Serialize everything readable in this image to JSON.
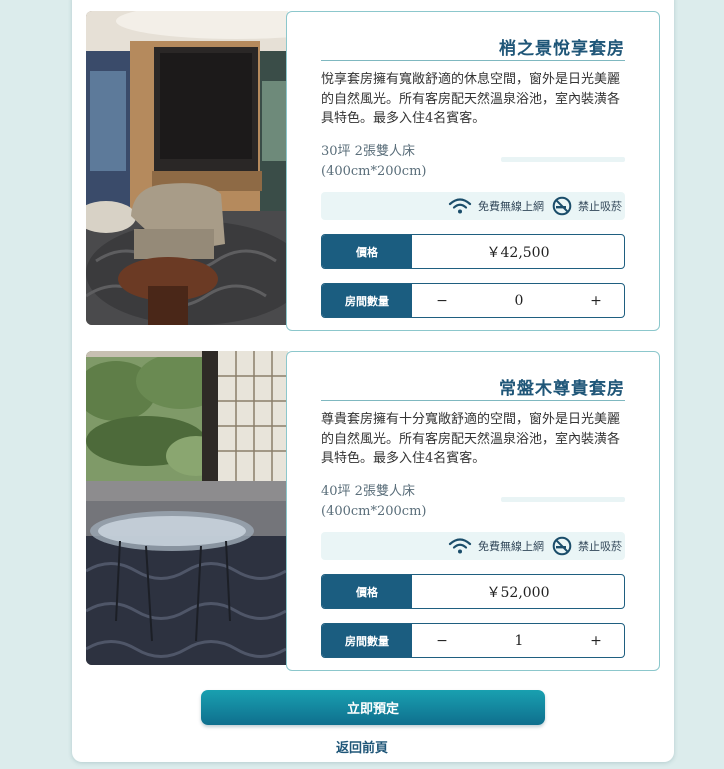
{
  "rooms": [
    {
      "title": "梢之景悅享套房",
      "description": "悅享套房擁有寬敞舒適的休息空間，窗外是日光美麗的自然風光。所有客房配天然溫泉浴池，室內裝潢各具特色。最多入住4名賓客。",
      "spec_line1": "30坪 2張雙人床",
      "spec_line2": "(400cm*200cm)",
      "amenity_wifi": "免費無線上網",
      "amenity_smoke": "禁止吸菸",
      "price_label": "價格",
      "price": "￥42,500",
      "qty_label": "房間數量",
      "qty_minus": "−",
      "qty_value": "0",
      "qty_plus": "+"
    },
    {
      "title": "常盤木尊貴套房",
      "description": "尊貴套房擁有十分寬敞舒適的空間，窗外是日光美麗的自然風光。所有客房配天然溫泉浴池，室內裝潢各具特色。最多入住4名賓客。",
      "spec_line1": "40坪 2張雙人床",
      "spec_line2": "(400cm*200cm)",
      "amenity_wifi": "免費無線上網",
      "amenity_smoke": "禁止吸菸",
      "price_label": "價格",
      "price": "￥52,000",
      "qty_label": "房間數量",
      "qty_minus": "−",
      "qty_value": "1",
      "qty_plus": "+"
    }
  ],
  "book_button": "立即預定",
  "back_link": "返回前頁",
  "colors": {
    "primary": "#1b5d80",
    "accent": "#14889f",
    "card_border": "#8cc7cc",
    "background": "#dcecec"
  },
  "icons": [
    "wifi-icon",
    "no-smoking-icon"
  ]
}
